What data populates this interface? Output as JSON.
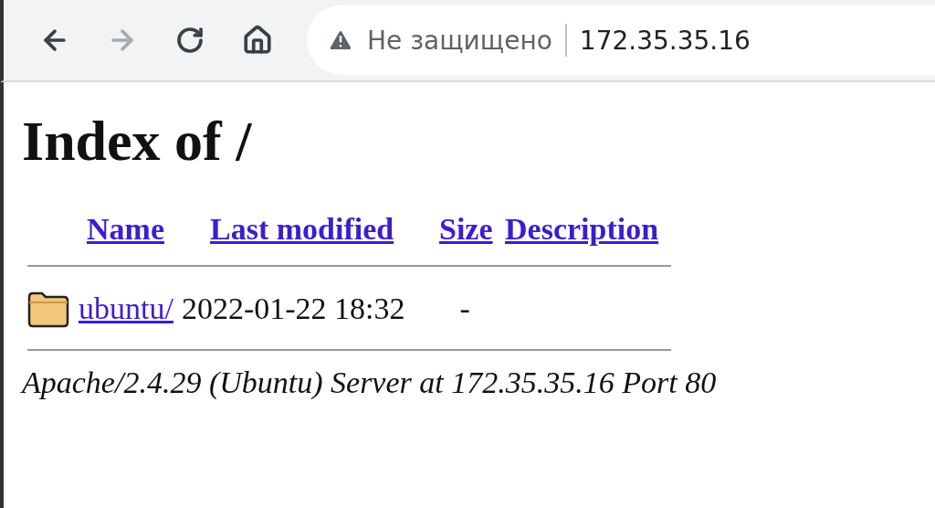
{
  "toolbar": {
    "nav_buttons": [
      {
        "kind": "back",
        "disabled": false
      },
      {
        "kind": "forward",
        "disabled": true
      },
      {
        "kind": "reload",
        "disabled": false
      },
      {
        "kind": "home",
        "disabled": false
      }
    ],
    "security": "Не защищено",
    "url": "172.35.35.16"
  },
  "page": {
    "title": "Index of /",
    "columns": [
      "Name",
      "Last modified",
      "Size",
      "Description"
    ],
    "rows": [
      {
        "kind": "folder",
        "name": "ubuntu/",
        "last_modified": "2022-01-22 18:32",
        "size": "-"
      }
    ],
    "footer": "Apache/2.4.29 (Ubuntu) Server at 172.35.35.16 Port 80"
  }
}
